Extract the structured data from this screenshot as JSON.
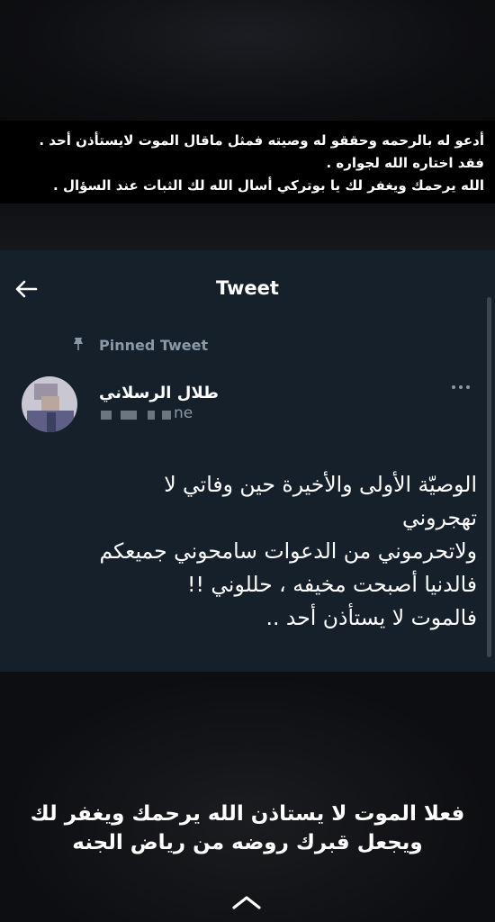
{
  "story_caption_top": {
    "lines": [
      "أدعو له بالرحمه وحققو له وصيته فمثل ماقال الموت لايستأذن أحد .",
      "فقد اختاره الله لجواره .",
      "الله يرحمك ويغفر لك يا بوتركي أسال الله لك الثبات عند السؤال ."
    ]
  },
  "tweet_header": {
    "title": "Tweet"
  },
  "pinned": {
    "label": "Pinned Tweet"
  },
  "author": {
    "display_name": "طلال الرسلاني",
    "handle_visible_suffix": "ne"
  },
  "tweet": {
    "lines": [
      "الوصيّة الأولى والأخيرة حين وفاتي لا",
      "تهجروني",
      "ولاتحرموني من الدعوات سامحوني جميعكم",
      "فالدنيا أصبحت مخيفه ، حللوني !!",
      "فالموت لا يستأذن أحد .."
    ]
  },
  "story_caption_bottom": {
    "lines": [
      "فعلا الموت لا يستاذن الله يرحمك ويغفر لك",
      "ويجعل قبرك روضه من رياض الجنه"
    ]
  },
  "icons": {
    "back": "arrow-left-icon",
    "pin": "pin-icon",
    "more": "more-horizontal-icon",
    "reply": "chevron-up-icon"
  },
  "colors": {
    "tweet_bg": "#15202b",
    "muted_text": "#8b98a5",
    "caption_bg": "#000000"
  }
}
